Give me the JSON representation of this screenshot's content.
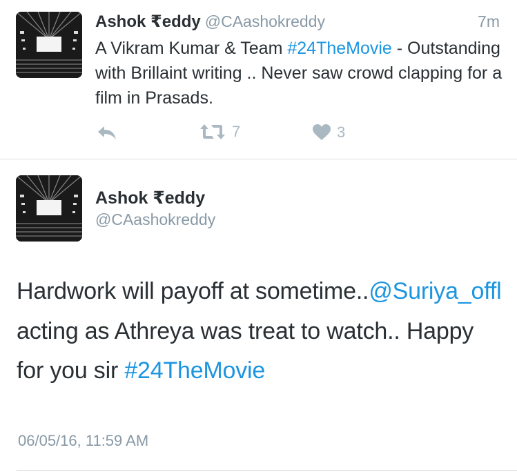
{
  "tweet1": {
    "author_name": "Ashok ₹eddy",
    "author_handle": "@CAashokreddy",
    "time_ago": "7m",
    "text_before": "A Vikram Kumar & Team ",
    "hashtag": "#24TheMovie",
    "text_after": "  - Outstanding with Brillaint writing .. Never saw crowd clapping for a film in Prasads.",
    "retweet_count": "7",
    "like_count": "3",
    "avatar_icon": "cinema-hall-image"
  },
  "tweet2": {
    "author_name": "Ashok ₹eddy",
    "author_handle": "@CAashokreddy",
    "text_part1": "Hardwork will payoff at sometime..",
    "mention": "@Suriya_offl",
    "text_part2": " acting as Athreya was treat to watch.. Happy for you sir ",
    "hashtag": "#24TheMovie",
    "timestamp": "06/05/16, 11:59 AM",
    "avatar_icon": "cinema-hall-image"
  },
  "colors": {
    "link": "#1b95e0",
    "secondary_text": "#8899a6",
    "primary_text": "#292f33",
    "action_icon": "#aab8c2",
    "divider": "#d8dde1"
  }
}
